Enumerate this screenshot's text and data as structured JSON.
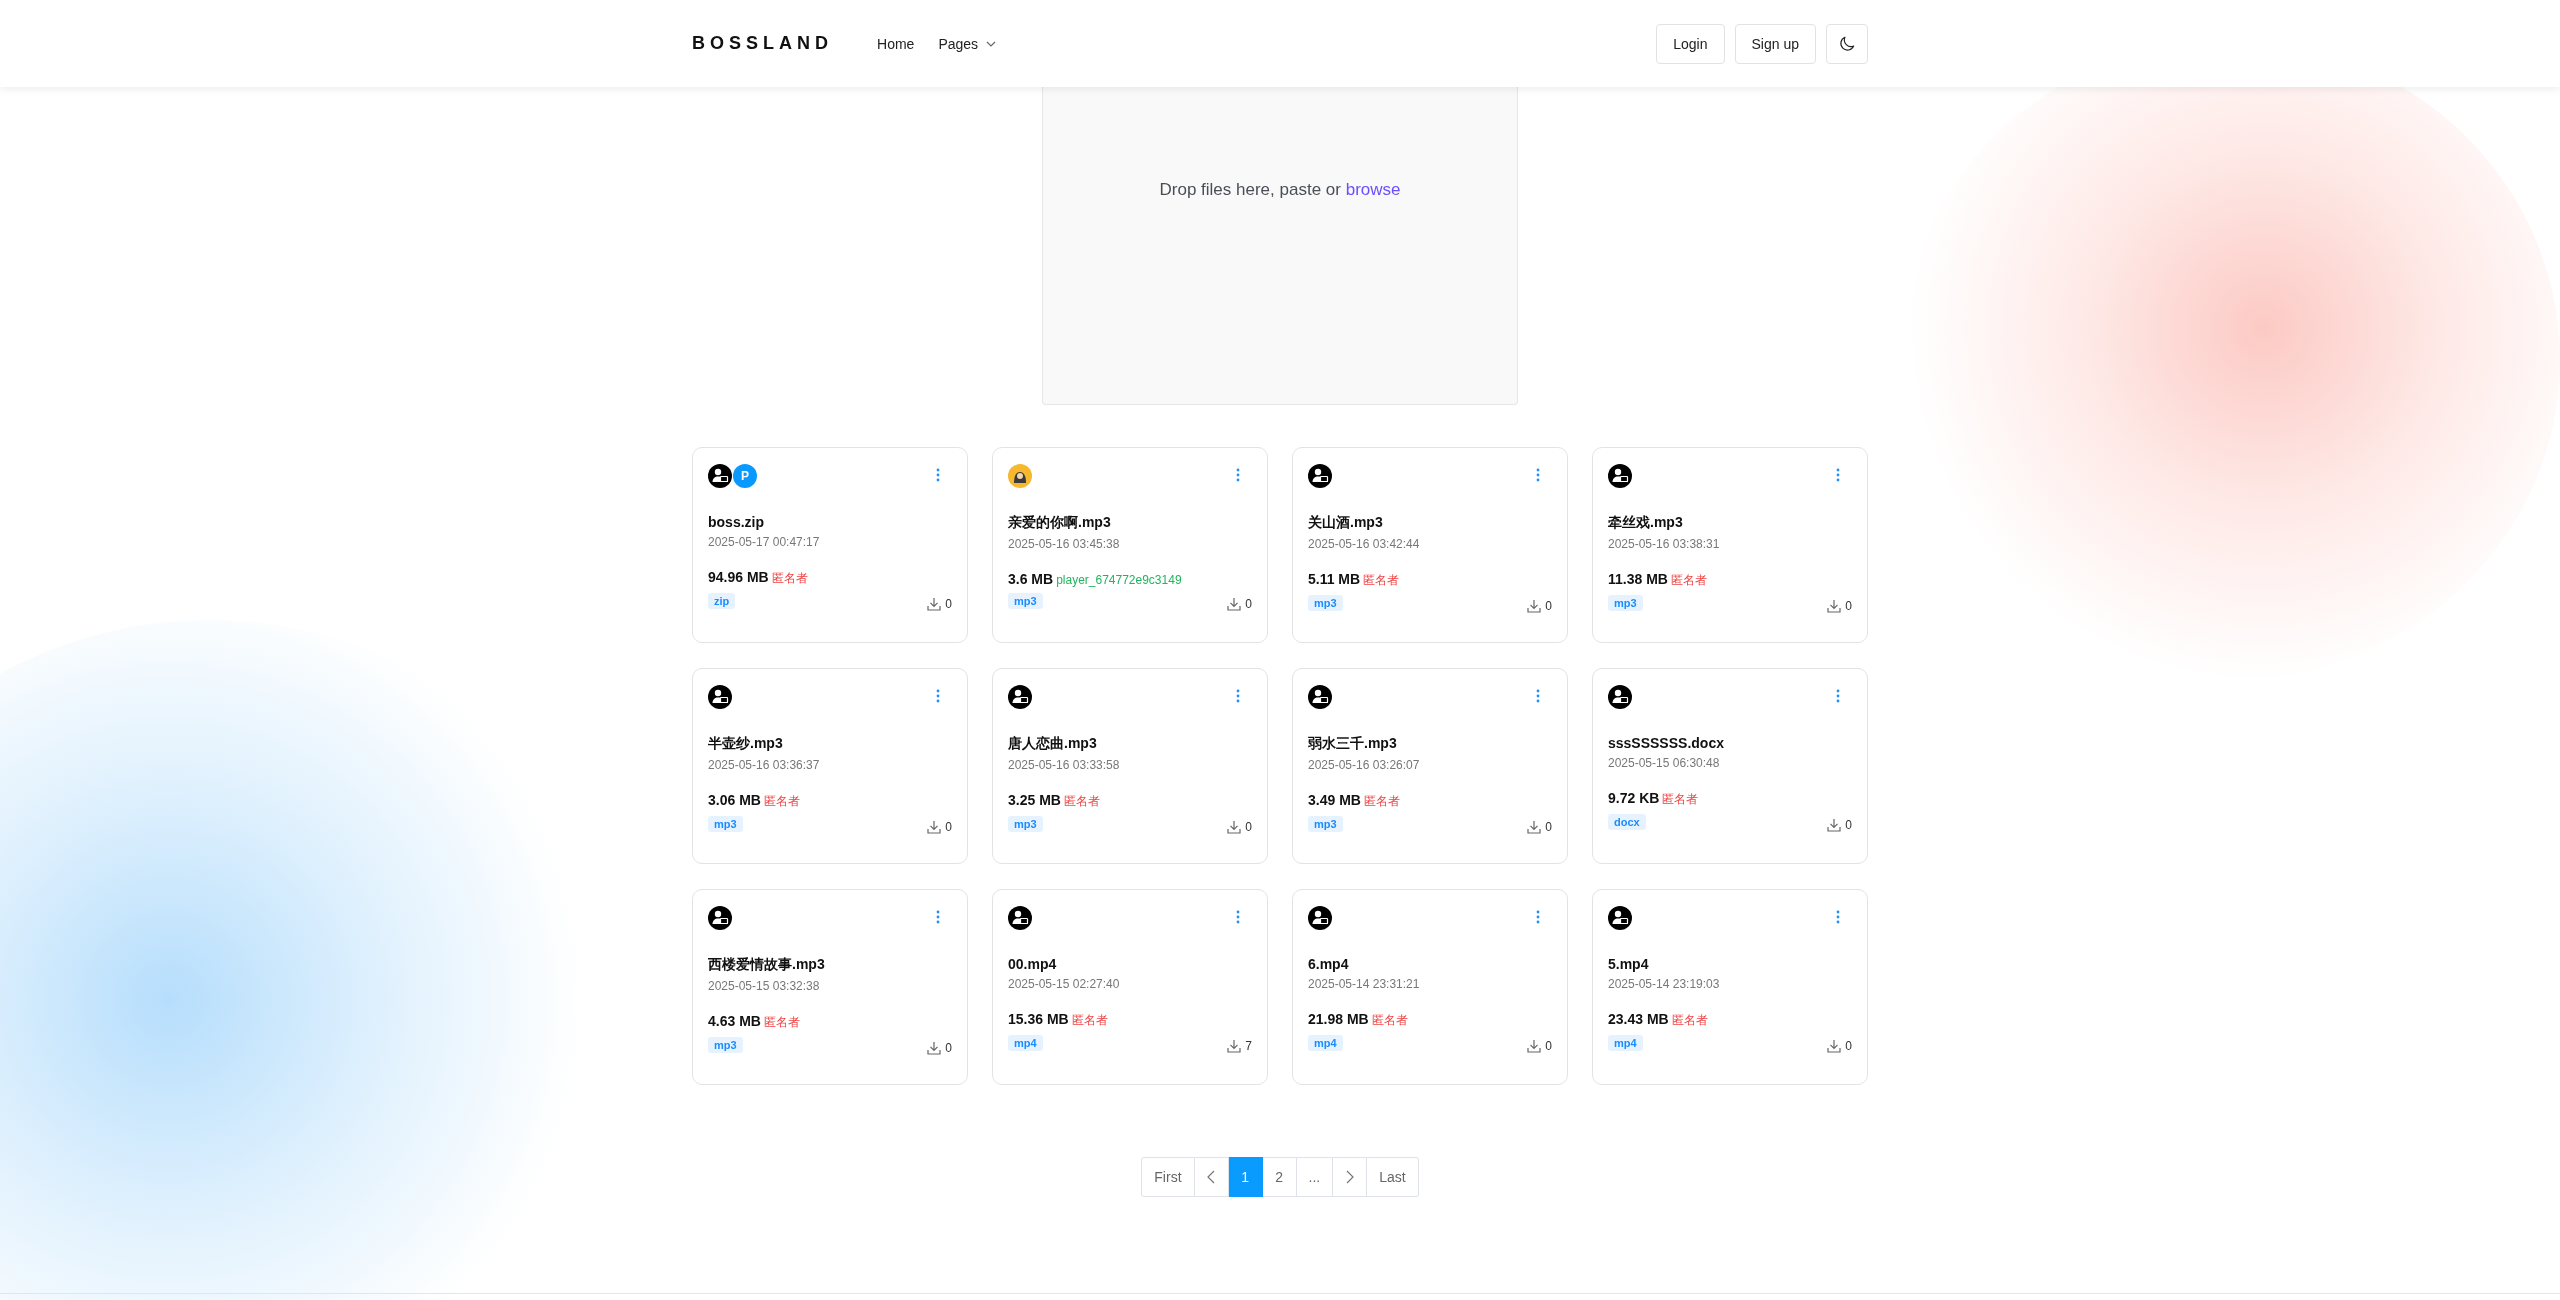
{
  "navbar": {
    "logo": "BOSSLAND",
    "links": [
      {
        "label": "Home",
        "kind": "link"
      },
      {
        "label": "Pages",
        "kind": "dropdown"
      }
    ],
    "buttons": [
      {
        "label": "Login"
      },
      {
        "label": "Sign up"
      }
    ]
  },
  "upload": {
    "text": "Drop files here, paste or ",
    "link": "browse"
  },
  "files": [
    {
      "avatars": [
        {
          "kind": "user"
        },
        {
          "kind": "letter",
          "text": "P"
        }
      ],
      "name": "boss.zip",
      "date": "2025-05-17 00:47:17",
      "size": "94.96 MB",
      "uploader": {
        "text": "匿名者",
        "color": "#ef4444"
      },
      "tag": "zip",
      "downloads": "0"
    },
    {
      "avatars": [
        {
          "kind": "photo"
        }
      ],
      "name": "亲爱的你啊.mp3",
      "date": "2025-05-16 03:45:38",
      "size": "3.6 MB",
      "uploader": {
        "text": "player_674772e9c3149",
        "color": "#22b35e"
      },
      "tag": "mp3",
      "downloads": "0"
    },
    {
      "avatars": [
        {
          "kind": "user"
        }
      ],
      "name": "关山酒.mp3",
      "date": "2025-05-16 03:42:44",
      "size": "5.11 MB",
      "uploader": {
        "text": "匿名者",
        "color": "#ef4444"
      },
      "tag": "mp3",
      "downloads": "0"
    },
    {
      "avatars": [
        {
          "kind": "user"
        }
      ],
      "name": "牵丝戏.mp3",
      "date": "2025-05-16 03:38:31",
      "size": "11.38 MB",
      "uploader": {
        "text": "匿名者",
        "color": "#ef4444"
      },
      "tag": "mp3",
      "downloads": "0"
    },
    {
      "avatars": [
        {
          "kind": "user"
        }
      ],
      "name": "半壶纱.mp3",
      "date": "2025-05-16 03:36:37",
      "size": "3.06 MB",
      "uploader": {
        "text": "匿名者",
        "color": "#ef4444"
      },
      "tag": "mp3",
      "downloads": "0"
    },
    {
      "avatars": [
        {
          "kind": "user"
        }
      ],
      "name": "唐人恋曲.mp3",
      "date": "2025-05-16 03:33:58",
      "size": "3.25 MB",
      "uploader": {
        "text": "匿名者",
        "color": "#ef4444"
      },
      "tag": "mp3",
      "downloads": "0"
    },
    {
      "avatars": [
        {
          "kind": "user"
        }
      ],
      "name": "弱水三千.mp3",
      "date": "2025-05-16 03:26:07",
      "size": "3.49 MB",
      "uploader": {
        "text": "匿名者",
        "color": "#ef4444"
      },
      "tag": "mp3",
      "downloads": "0"
    },
    {
      "avatars": [
        {
          "kind": "user"
        }
      ],
      "name": "sssSSSSSS.docx",
      "date": "2025-05-15 06:30:48",
      "size": "9.72 KB",
      "uploader": {
        "text": "匿名者",
        "color": "#ef4444"
      },
      "tag": "docx",
      "downloads": "0"
    },
    {
      "avatars": [
        {
          "kind": "user"
        }
      ],
      "name": "西楼爱情故事.mp3",
      "date": "2025-05-15 03:32:38",
      "size": "4.63 MB",
      "uploader": {
        "text": "匿名者",
        "color": "#ef4444"
      },
      "tag": "mp3",
      "downloads": "0"
    },
    {
      "avatars": [
        {
          "kind": "user"
        }
      ],
      "name": "00.mp4",
      "date": "2025-05-15 02:27:40",
      "size": "15.36 MB",
      "uploader": {
        "text": "匿名者",
        "color": "#ef4444"
      },
      "tag": "mp4",
      "downloads": "7"
    },
    {
      "avatars": [
        {
          "kind": "user"
        }
      ],
      "name": "6.mp4",
      "date": "2025-05-14 23:31:21",
      "size": "21.98 MB",
      "uploader": {
        "text": "匿名者",
        "color": "#ef4444"
      },
      "tag": "mp4",
      "downloads": "0"
    },
    {
      "avatars": [
        {
          "kind": "user"
        }
      ],
      "name": "5.mp4",
      "date": "2025-05-14 23:19:03",
      "size": "23.43 MB",
      "uploader": {
        "text": "匿名者",
        "color": "#ef4444"
      },
      "tag": "mp4",
      "downloads": "0"
    }
  ],
  "pagination": [
    {
      "kind": "text",
      "label": "First",
      "selected": false
    },
    {
      "kind": "prev",
      "selected": false
    },
    {
      "kind": "text",
      "label": "1",
      "selected": true
    },
    {
      "kind": "text",
      "label": "2",
      "selected": false
    },
    {
      "kind": "text",
      "label": "...",
      "selected": false
    },
    {
      "kind": "next",
      "selected": false
    },
    {
      "kind": "text",
      "label": "Last",
      "selected": false
    }
  ]
}
